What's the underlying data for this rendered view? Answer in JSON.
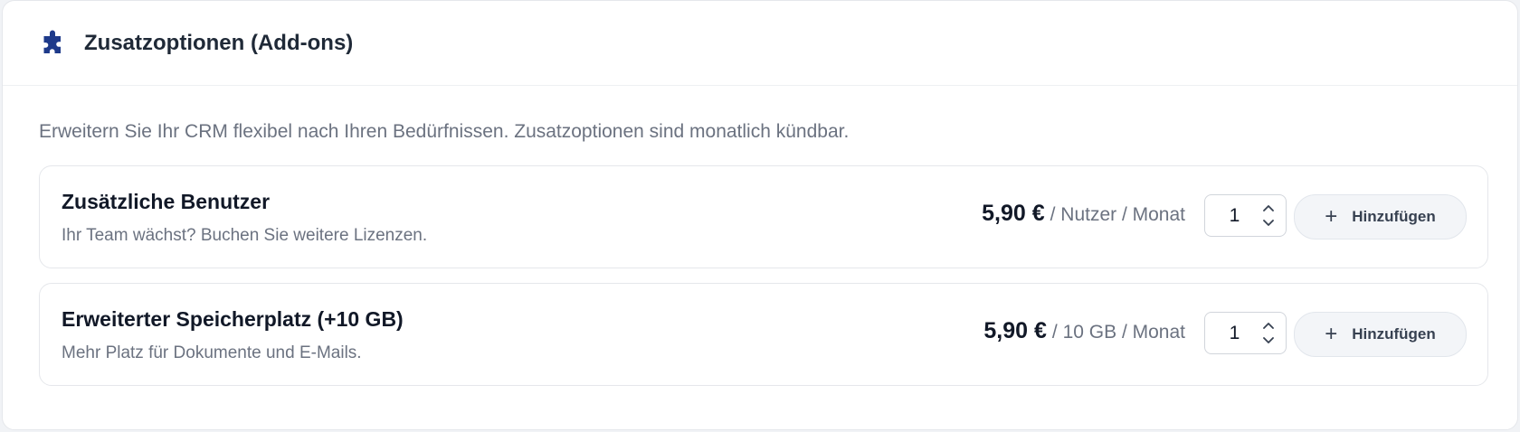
{
  "header": {
    "icon": "puzzle-icon",
    "title": "Zusatzoptionen (Add-ons)"
  },
  "intro": "Erweitern Sie Ihr CRM flexibel nach Ihren Bedürfnissen. Zusatzoptionen sind monatlich kündbar.",
  "addons": [
    {
      "title": "Zusätzliche Benutzer",
      "description": "Ihr Team wächst? Buchen Sie weitere Lizenzen.",
      "price": "5,90 €",
      "unit": "/ Nutzer / Monat",
      "quantity": "1",
      "button_label": "Hinzufügen"
    },
    {
      "title": "Erweiterter Speicherplatz (+10 GB)",
      "description": "Mehr Platz für Dokumente und E-Mails.",
      "price": "5,90 €",
      "unit": "/ 10 GB / Monat",
      "quantity": "1",
      "button_label": "Hinzufügen"
    }
  ],
  "colors": {
    "icon": "#1e3a8a",
    "text_muted": "#6b7280",
    "button_bg": "#f3f5f8"
  }
}
